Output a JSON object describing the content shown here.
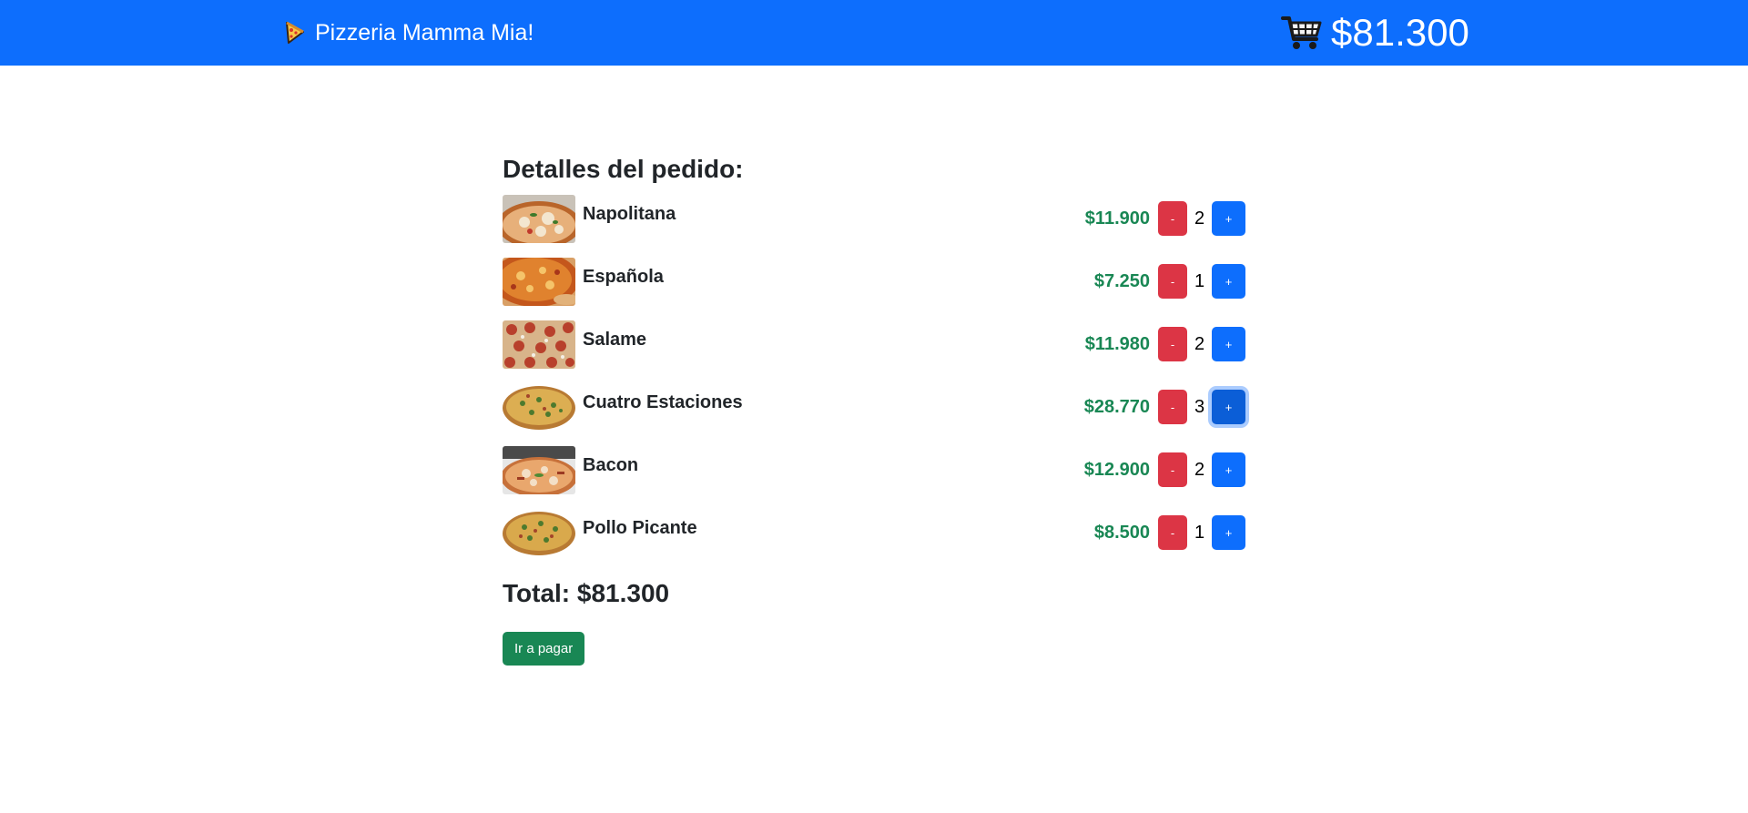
{
  "navbar": {
    "brand_icon": "pizza-slice-icon",
    "brand_label": "Pizzeria Mamma Mia!",
    "cart_icon": "shopping-cart-icon",
    "cart_total": "$81.300",
    "background": "#0d6efd"
  },
  "order": {
    "title": "Detalles del pedido:",
    "items": [
      {
        "name": "Napolitana",
        "price": "$11.900",
        "qty": "2",
        "minus": "-",
        "plus": "+"
      },
      {
        "name": "Española",
        "price": "$7.250",
        "qty": "1",
        "minus": "-",
        "plus": "+"
      },
      {
        "name": "Salame",
        "price": "$11.980",
        "qty": "2",
        "minus": "-",
        "plus": "+"
      },
      {
        "name": "Cuatro Estaciones",
        "price": "$28.770",
        "qty": "3",
        "minus": "-",
        "plus": "+"
      },
      {
        "name": "Bacon",
        "price": "$12.900",
        "qty": "2",
        "minus": "-",
        "plus": "+"
      },
      {
        "name": "Pollo Picante",
        "price": "$8.500",
        "qty": "1",
        "minus": "-",
        "plus": "+"
      }
    ],
    "total": "Total: $81.300",
    "pay_label": "Ir a pagar"
  },
  "colors": {
    "primary": "#0d6efd",
    "danger": "#dc3545",
    "success": "#198754"
  }
}
